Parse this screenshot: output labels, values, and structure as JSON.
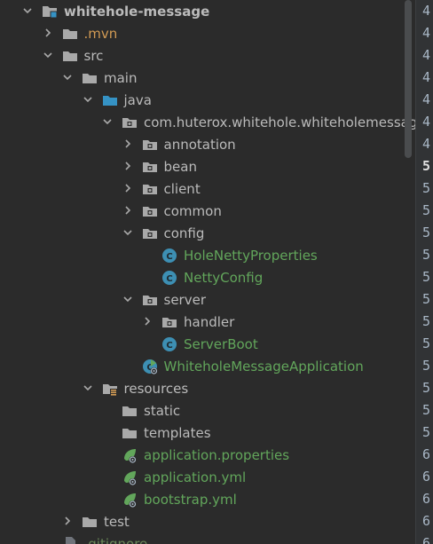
{
  "project_tree": {
    "nodes": [
      {
        "label": "whitehole-message",
        "icon": "module-folder-icon",
        "expanded": true,
        "depth": 0,
        "style": "bold",
        "name": "tree-item-whitehole-message"
      },
      {
        "label": ".mvn",
        "icon": "folder-icon",
        "expanded": false,
        "depth": 1,
        "style": "orange",
        "name": "tree-item-mvn"
      },
      {
        "label": "src",
        "icon": "folder-icon",
        "expanded": true,
        "depth": 1,
        "style": "",
        "name": "tree-item-src"
      },
      {
        "label": "main",
        "icon": "folder-icon",
        "expanded": true,
        "depth": 2,
        "style": "",
        "name": "tree-item-main"
      },
      {
        "label": "java",
        "icon": "source-root-icon",
        "expanded": true,
        "depth": 3,
        "style": "",
        "name": "tree-item-java"
      },
      {
        "label": "com.huterox.whitehole.whiteholemessage",
        "icon": "package-icon",
        "expanded": true,
        "depth": 4,
        "style": "",
        "name": "tree-item-root-package"
      },
      {
        "label": "annotation",
        "icon": "package-icon",
        "expanded": false,
        "depth": 5,
        "style": "",
        "name": "tree-item-annotation"
      },
      {
        "label": "bean",
        "icon": "package-icon",
        "expanded": false,
        "depth": 5,
        "style": "",
        "name": "tree-item-bean"
      },
      {
        "label": "client",
        "icon": "package-icon",
        "expanded": false,
        "depth": 5,
        "style": "",
        "name": "tree-item-client"
      },
      {
        "label": "common",
        "icon": "package-icon",
        "expanded": false,
        "depth": 5,
        "style": "",
        "name": "tree-item-common"
      },
      {
        "label": "config",
        "icon": "package-icon",
        "expanded": true,
        "depth": 5,
        "style": "",
        "name": "tree-item-config"
      },
      {
        "label": "HoleNettyProperties",
        "icon": "class-icon",
        "expanded": null,
        "depth": 6,
        "style": "green",
        "name": "tree-item-holenettyproperties"
      },
      {
        "label": "NettyConfig",
        "icon": "class-icon",
        "expanded": null,
        "depth": 6,
        "style": "green",
        "name": "tree-item-nettyconfig"
      },
      {
        "label": "server",
        "icon": "package-icon",
        "expanded": true,
        "depth": 5,
        "style": "",
        "name": "tree-item-server"
      },
      {
        "label": "handler",
        "icon": "package-icon",
        "expanded": false,
        "depth": 6,
        "style": "",
        "name": "tree-item-handler"
      },
      {
        "label": "ServerBoot",
        "icon": "class-icon",
        "expanded": null,
        "depth": 6,
        "style": "green",
        "name": "tree-item-serverboot"
      },
      {
        "label": "WhiteholeMessageApplication",
        "icon": "spring-boot-class-icon",
        "expanded": null,
        "depth": 5,
        "style": "green",
        "name": "tree-item-whiteholemessageapplication"
      },
      {
        "label": "resources",
        "icon": "resources-folder-icon",
        "expanded": true,
        "depth": 3,
        "style": "",
        "name": "tree-item-resources"
      },
      {
        "label": "static",
        "icon": "folder-icon",
        "expanded": null,
        "depth": 4,
        "style": "",
        "name": "tree-item-static"
      },
      {
        "label": "templates",
        "icon": "folder-icon",
        "expanded": null,
        "depth": 4,
        "style": "",
        "name": "tree-item-templates"
      },
      {
        "label": "application.properties",
        "icon": "spring-config-icon",
        "expanded": null,
        "depth": 4,
        "style": "green",
        "name": "tree-item-application-properties"
      },
      {
        "label": "application.yml",
        "icon": "spring-config-icon",
        "expanded": null,
        "depth": 4,
        "style": "green",
        "name": "tree-item-application-yml"
      },
      {
        "label": "bootstrap.yml",
        "icon": "spring-config-icon",
        "expanded": null,
        "depth": 4,
        "style": "green",
        "name": "tree-item-bootstrap-yml"
      },
      {
        "label": "test",
        "icon": "folder-icon",
        "expanded": false,
        "depth": 2,
        "style": "",
        "name": "tree-item-test"
      },
      {
        "label": ".gitignore",
        "icon": "file-icon",
        "expanded": null,
        "depth": 1,
        "style": "dim",
        "name": "tree-item-gitignore"
      }
    ]
  },
  "gutter": {
    "numbers": [
      "4",
      "4",
      "4",
      "4",
      "4",
      "4",
      "4",
      "5",
      "5",
      "5",
      "5",
      "5",
      "5",
      "5",
      "5",
      "5",
      "5",
      "5",
      "5",
      "5",
      "6",
      "6",
      "6",
      "6",
      "6"
    ]
  },
  "colors": {
    "background": "#2b2b2b",
    "text": "#bbbbbb",
    "excluded_folder": "#d29b54",
    "class_name": "#62a65b",
    "folder_icon": "#a9a9a9",
    "source_root_icon": "#3592c4",
    "class_icon": "#3d8fb3",
    "spring_icon": "#62a65b"
  }
}
